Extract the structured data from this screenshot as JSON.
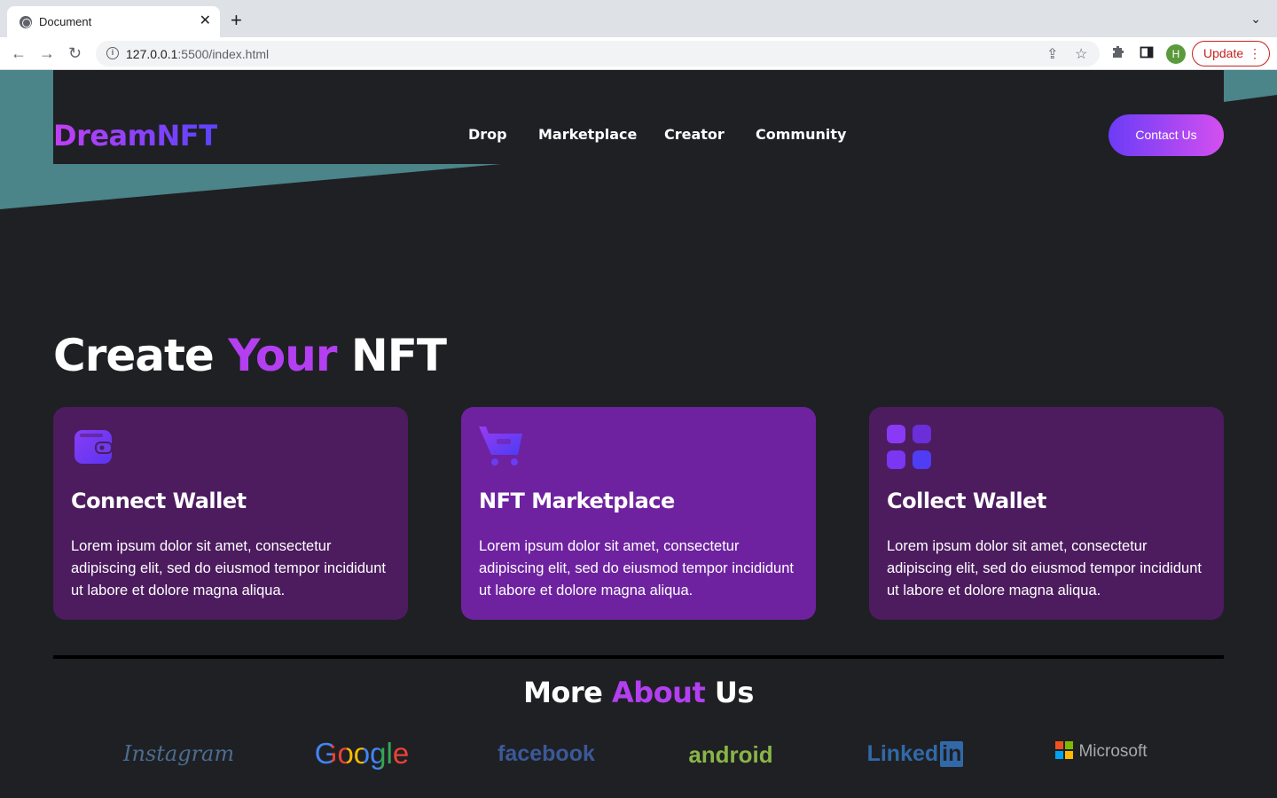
{
  "browser": {
    "tab_title": "Document",
    "tab_close": "✕",
    "new_tab": "+",
    "tab_search": "⌄",
    "url_host": "127.0.0.1",
    "url_rest": ":5500/index.html",
    "profile_initial": "H",
    "update_label": "Update",
    "update_menu": "⋮"
  },
  "site": {
    "logo": "DreamNFT",
    "nav": [
      "Drop",
      "Marketplace",
      "Creator",
      "Community"
    ],
    "contact_label": "Contact Us"
  },
  "hero": {
    "title_part1": "Create ",
    "title_accent": "Your",
    "title_part2": " NFT"
  },
  "cards": [
    {
      "icon": "wallet-icon",
      "title": "Connect Wallet",
      "body": "Lorem ipsum dolor sit amet, consectetur adipiscing elit, sed do eiusmod tempor incididunt ut labore et dolore magna aliqua."
    },
    {
      "icon": "cart-icon",
      "title": "NFT Marketplace",
      "body": "Lorem ipsum dolor sit amet, consectetur adipiscing elit, sed do eiusmod tempor incididunt ut labore et dolore magna aliqua."
    },
    {
      "icon": "grid-icon",
      "title": "Collect Wallet",
      "body": "Lorem ipsum dolor sit amet, consectetur adipiscing elit, sed do eiusmod tempor incididunt ut labore et dolore magna aliqua."
    }
  ],
  "about": {
    "title_part1": "More ",
    "title_accent": "About",
    "title_part2": " Us"
  },
  "brands": {
    "instagram": "Instagram",
    "google": "Google",
    "facebook": "facebook",
    "android": "android",
    "linkedin_text": "Linked",
    "linkedin_box": "in",
    "microsoft": "Microsoft"
  },
  "colors": {
    "page_bg": "#1f2024",
    "teal_shape": "#4b8489",
    "accent_purple": "#b33ff0",
    "card_dark": "#4c1c5f",
    "card_light": "#6e22a0"
  }
}
